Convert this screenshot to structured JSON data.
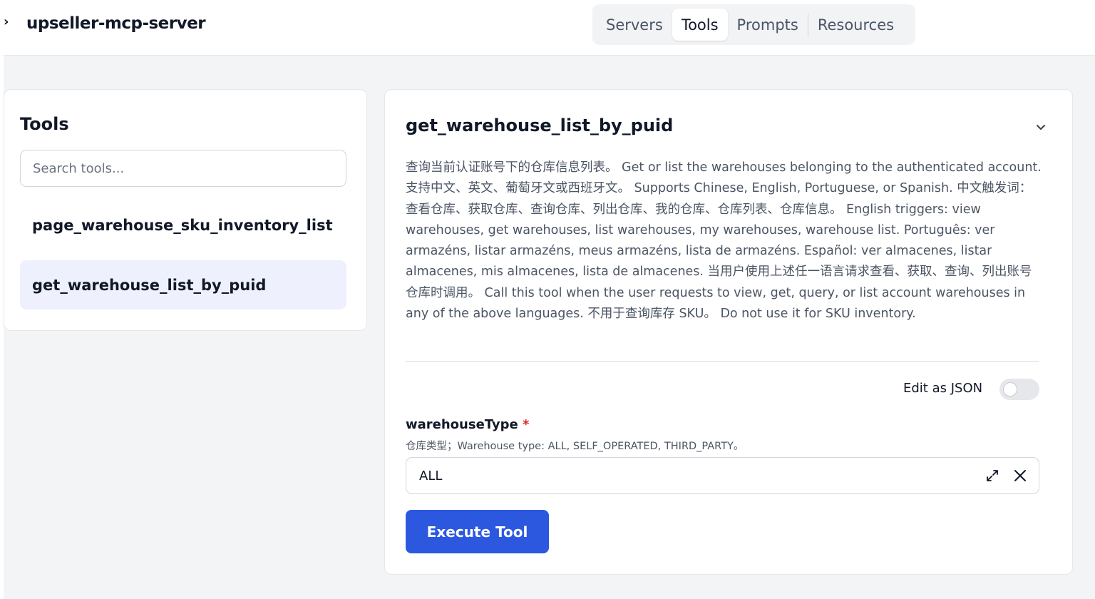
{
  "header": {
    "server_name": "upseller-mcp-server",
    "tabs": [
      {
        "label": "Servers"
      },
      {
        "label": "Tools"
      },
      {
        "label": "Prompts"
      },
      {
        "label": "Resources"
      }
    ],
    "active_tab": "Tools"
  },
  "tools_panel": {
    "title": "Tools",
    "search_placeholder": "Search tools...",
    "items": [
      {
        "label": "page_warehouse_sku_inventory_list",
        "selected": false
      },
      {
        "label": "get_warehouse_list_by_puid",
        "selected": true
      }
    ]
  },
  "detail": {
    "title": "get_warehouse_list_by_puid",
    "description": "查询当前认证账号下的仓库信息列表。 Get or list the warehouses belonging to the authenticated account. 支持中文、英文、葡萄牙文或西班牙文。 Supports Chinese, English, Portuguese, or Spanish. 中文触发词：查看仓库、获取仓库、查询仓库、列出仓库、我的仓库、仓库列表、仓库信息。 English triggers: view warehouses, get warehouses, list warehouses, my warehouses, warehouse list. Português: ver armazéns, listar armazéns, meus armazéns, lista de armazéns. Español: ver almacenes, listar almacenes, mis almacenes, lista de almacenes. 当用户使用上述任一语言请求查看、获取、查询、列出账号仓库时调用。 Call this tool when the user requests to view, get, query, or list account warehouses in any of the above languages. 不用于查询库存 SKU。 Do not use it for SKU inventory.",
    "edit_json_label": "Edit as JSON",
    "edit_json_enabled": false,
    "param": {
      "name": "warehouseType",
      "required_mark": "*",
      "description": "仓库类型；Warehouse type: ALL, SELF_OPERATED, THIRD_PARTY。",
      "value": "ALL"
    },
    "execute_label": "Execute Tool"
  },
  "colors": {
    "accent": "#2c58e0",
    "selected_item_bg": "#eef1fd",
    "page_bg": "#f3f4f6",
    "required": "#dc2626"
  },
  "icons": [
    "sidebar-collapse-icon",
    "chevron-down-icon",
    "expand-icon",
    "close-icon"
  ]
}
